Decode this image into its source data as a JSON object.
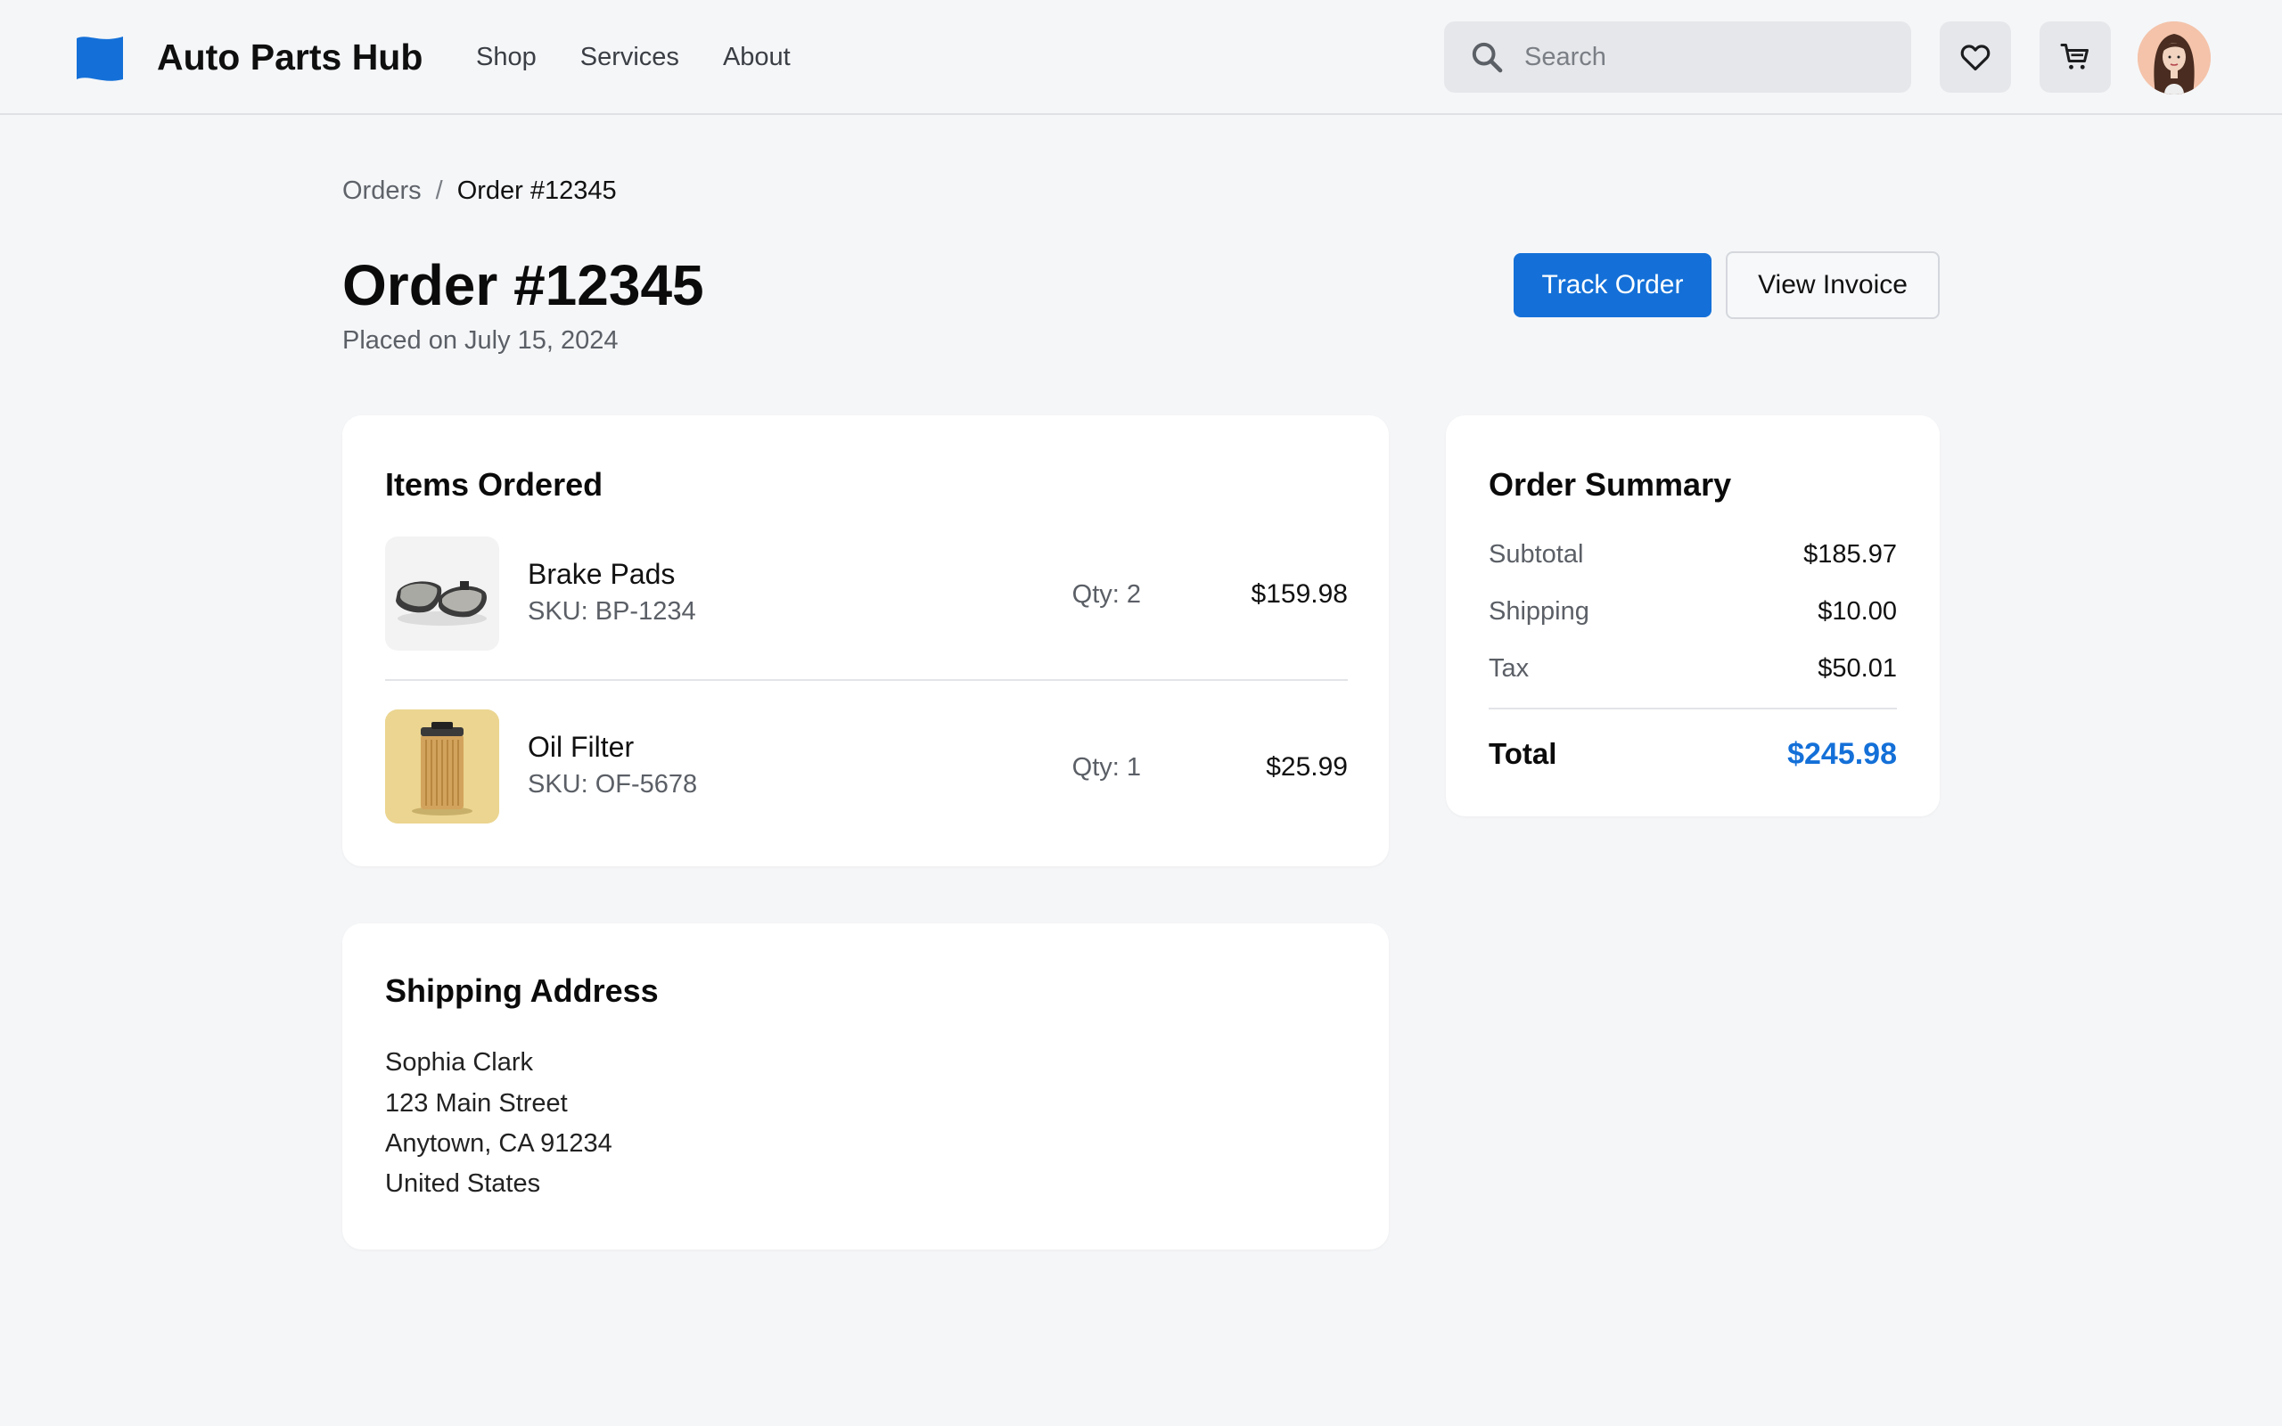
{
  "header": {
    "brand": "Auto Parts Hub",
    "nav": [
      "Shop",
      "Services",
      "About"
    ],
    "search_placeholder": "Search",
    "icons": {
      "logo": "flag-logo-icon",
      "search": "search-icon",
      "wishlist": "heart-icon",
      "cart": "cart-icon"
    },
    "accent_color": "#1470d8"
  },
  "breadcrumb": {
    "parent": "Orders",
    "separator": "/",
    "current": "Order #12345"
  },
  "order": {
    "title": "Order #12345",
    "placed_on": "Placed on July 15, 2024",
    "track_label": "Track Order",
    "invoice_label": "View Invoice"
  },
  "items": {
    "title": "Items Ordered",
    "list": [
      {
        "name": "Brake Pads",
        "sku": "SKU: BP-1234",
        "qty": "Qty: 2",
        "price": "$159.98"
      },
      {
        "name": "Oil Filter",
        "sku": "SKU: OF-5678",
        "qty": "Qty: 1",
        "price": "$25.99"
      }
    ]
  },
  "summary": {
    "title": "Order Summary",
    "subtotal_label": "Subtotal",
    "subtotal": "$185.97",
    "shipping_label": "Shipping",
    "shipping": "$10.00",
    "tax_label": "Tax",
    "tax": "$50.01",
    "total_label": "Total",
    "total": "$245.98"
  },
  "shipping_address": {
    "title": "Shipping Address",
    "lines": [
      "Sophia Clark",
      "123 Main Street",
      "Anytown, CA 91234",
      "United States"
    ]
  }
}
